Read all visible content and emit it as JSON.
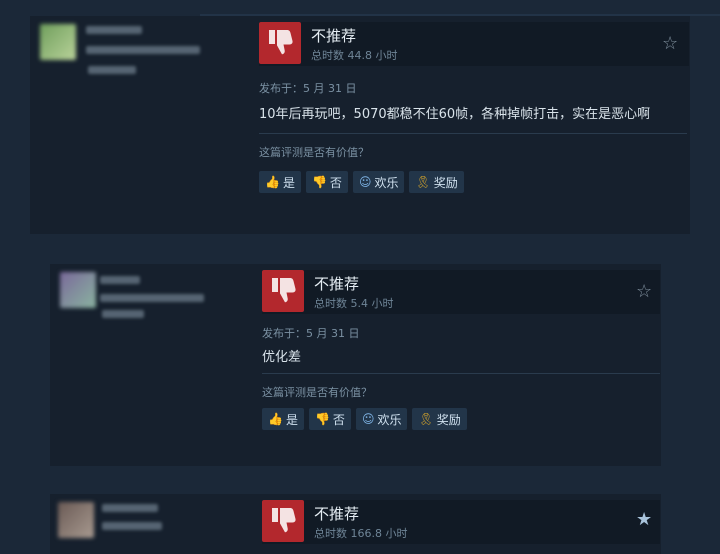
{
  "reviews": [
    {
      "verdict": "不推荐",
      "hours": "总时数 44.8 小时",
      "posted": "发布于：5 月 31 日",
      "text": "10年后再玩吧，5070都稳不住60帧，各种掉帧打击，实在是恶心啊",
      "helpful_prompt": "这篇评测是否有价值？",
      "buttons": {
        "yes": "是",
        "no": "否",
        "funny": "欢乐",
        "award": "奖励"
      },
      "starred": false
    },
    {
      "verdict": "不推荐",
      "hours": "总时数 5.4 小时",
      "posted": "发布于：5 月 31 日",
      "text": "优化差",
      "helpful_prompt": "这篇评测是否有价值？",
      "buttons": {
        "yes": "是",
        "no": "否",
        "funny": "欢乐",
        "award": "奖励"
      },
      "starred": false
    },
    {
      "verdict": "不推荐",
      "hours": "总时数 166.8 小时",
      "starred": true
    }
  ],
  "colors": {
    "page_bg": "#1b2838",
    "card_bg": "#16202d",
    "thumb_down_red": "#b3282d",
    "award_gold": "#d9a72a"
  },
  "icons": {
    "verdict": "thumbs-down-icon",
    "yes": "thumbs-up-icon",
    "no": "thumbs-down-icon",
    "funny": "smiley-icon",
    "award": "award-ribbon-icon",
    "favorite": "star-icon"
  }
}
